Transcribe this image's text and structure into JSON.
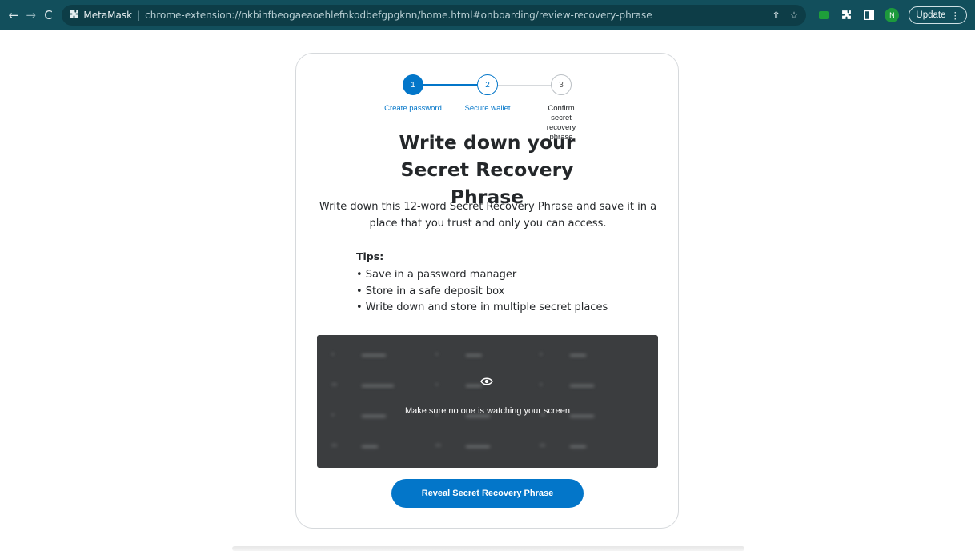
{
  "browser": {
    "back_glyph": "←",
    "forward_glyph": "→",
    "reload_glyph": "C",
    "site_name": "MetaMask",
    "separator": "|",
    "url": "chrome-extension://nkbihfbeogaeaoehlefnkodbefgpgknn/home.html#onboarding/review-recovery-phrase",
    "share_glyph": "⇧",
    "star_glyph": "☆",
    "avatar_letter": "N",
    "update_label": "Update",
    "menu_glyph": "⋮"
  },
  "stepper": {
    "steps": [
      {
        "number": "1",
        "label": "Create password"
      },
      {
        "number": "2",
        "label": "Secure wallet"
      },
      {
        "number": "3",
        "label": "Confirm secret recovery phrase"
      }
    ]
  },
  "page": {
    "title": "Write down your Secret Recovery Phrase",
    "subtitle": "Write down this 12-word Secret Recovery Phrase and save it in a place that you trust and only you can access.",
    "tips_title": "Tips:",
    "tips": [
      "• Save in a password manager",
      "• Store in a safe deposit box",
      "• Write down and store in multiple secret places"
    ],
    "privacy_warning": "Make sure no one is watching your screen",
    "reveal_button": "Reveal Secret Recovery Phrase"
  },
  "colors": {
    "chrome_bg": "#124f5c",
    "primary": "#0376c9",
    "phrase_box": "#3b3d3f"
  },
  "icons": [
    "arrow-left-icon",
    "arrow-right-icon",
    "reload-icon",
    "puzzle-icon",
    "share-icon",
    "star-icon",
    "metamask-fox-icon",
    "extensions-icon",
    "sidepanel-icon",
    "eye-icon",
    "kebab-menu-icon"
  ]
}
